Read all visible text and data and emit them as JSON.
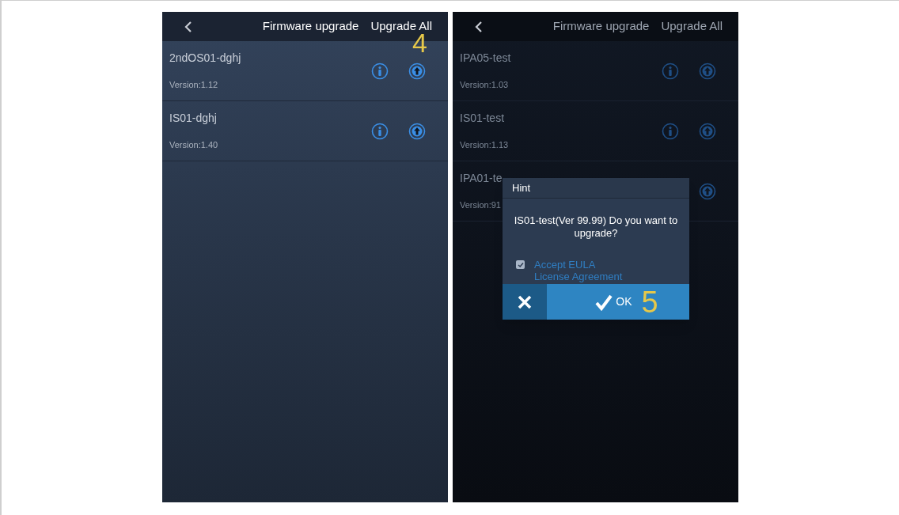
{
  "screens": [
    {
      "header": {
        "title": "Firmware upgrade",
        "action": "Upgrade All"
      },
      "callout": "4",
      "dimmed": false,
      "devices": [
        {
          "name": "2ndOS01-dghj",
          "version": "Version:1.12"
        },
        {
          "name": "IS01-dghj",
          "version": "Version:1.40"
        }
      ]
    },
    {
      "header": {
        "title": "Firmware upgrade",
        "action": "Upgrade All"
      },
      "dimmed": true,
      "devices": [
        {
          "name": "IPA05-test",
          "version": "Version:1.03"
        },
        {
          "name": "IS01-test",
          "version": "Version:1.13"
        },
        {
          "name": "IPA01-te",
          "version": "Version:91"
        }
      ],
      "dialog": {
        "title": "Hint",
        "message": "IS01-test(Ver 99.99) Do you want to upgrade?",
        "checkbox": {
          "label_lines": [
            "Accept EULA",
            "License Agreement"
          ],
          "checked": true
        },
        "ok": "OK",
        "callout": "5"
      }
    }
  ]
}
